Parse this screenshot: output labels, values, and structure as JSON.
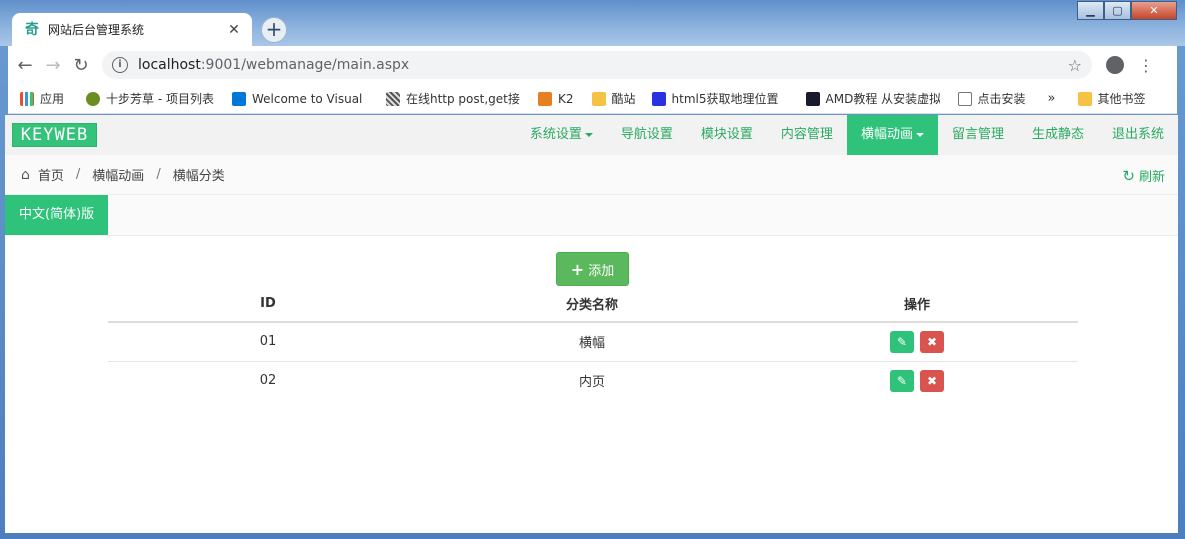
{
  "browser": {
    "tab_title": "网站后台管理系统",
    "url_host": "localhost",
    "url_rest": ":9001/webmanage/main.aspx",
    "bookmarks": [
      {
        "label": "应用",
        "icon": "apps-grid-icon",
        "color": "#e74c3c"
      },
      {
        "label": "十步芳草 - 项目列表",
        "icon": "tree-icon",
        "color": "#6b8e23"
      },
      {
        "label": "Welcome to Visual",
        "icon": "azure-devops-icon",
        "color": "#0078d7"
      },
      {
        "label": "在线http post,get接",
        "icon": "qr-icon",
        "color": "#555555"
      },
      {
        "label": "K2",
        "icon": "k2-icon",
        "color": "#e67e22"
      },
      {
        "label": "酷站",
        "icon": "folder-icon",
        "color": "#f6c244"
      },
      {
        "label": "html5获取地理位置",
        "icon": "baidu-paw-icon",
        "color": "#2932e1"
      },
      {
        "label": "AMD教程 从安装虚拟",
        "icon": "amd-icon",
        "color": "#1a1a2e"
      },
      {
        "label": "点击安装",
        "icon": "page-icon",
        "color": "#ffffff"
      }
    ],
    "bookmarks_more": "»",
    "other_bookmarks": "其他书签"
  },
  "navbar": {
    "logo": "KEYWEB",
    "menu": [
      {
        "label": "系统设置",
        "dropdown": true,
        "active": false
      },
      {
        "label": "导航设置",
        "dropdown": false,
        "active": false
      },
      {
        "label": "模块设置",
        "dropdown": false,
        "active": false
      },
      {
        "label": "内容管理",
        "dropdown": false,
        "active": false
      },
      {
        "label": "横幅动画",
        "dropdown": true,
        "active": true
      },
      {
        "label": "留言管理",
        "dropdown": false,
        "active": false
      },
      {
        "label": "生成静态",
        "dropdown": false,
        "active": false
      },
      {
        "label": "退出系统",
        "dropdown": false,
        "active": false
      }
    ]
  },
  "breadcrumb": {
    "items": [
      "首页",
      "横幅动画",
      "横幅分类"
    ],
    "separator": "/",
    "refresh": "刷新"
  },
  "language_tab": "中文(简体)版",
  "add_button": "添加",
  "table": {
    "headers": {
      "id": "ID",
      "name": "分类名称",
      "ops": "操作"
    },
    "rows": [
      {
        "id": "01",
        "name": "横幅"
      },
      {
        "id": "02",
        "name": "内页"
      }
    ]
  },
  "colors": {
    "accent": "#2ec27a",
    "add_green": "#5cb85c",
    "delete_red": "#d9534f"
  }
}
